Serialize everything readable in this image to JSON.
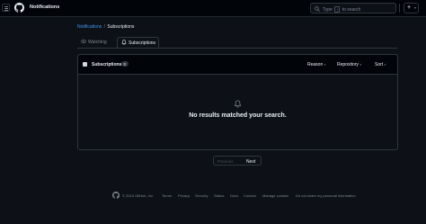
{
  "header": {
    "title": "Notifications",
    "search_placeholder_before": "Type",
    "search_key": "/",
    "search_placeholder_after": "to search",
    "plus_icon": "+",
    "caret_icon": "▾"
  },
  "breadcrumb": {
    "parent": "Notifications",
    "separator": "/",
    "current": "Subscriptions"
  },
  "tabs": {
    "watching": "Watching",
    "subscriptions": "Subscriptions"
  },
  "list": {
    "title": "Subscriptions",
    "count": "0",
    "filters": {
      "reason": "Reason",
      "repository": "Repository",
      "sort": "Sort"
    },
    "dropdown_icon": "▾",
    "empty_message": "No results matched your search."
  },
  "pagination": {
    "previous": "Previous",
    "next": "Next"
  },
  "footer": {
    "copyright": "© 2024 GitHub, Inc.",
    "links": [
      "Terms",
      "Privacy",
      "Security",
      "Status",
      "Docs",
      "Contact",
      "Manage cookies",
      "Do not share my personal information"
    ]
  },
  "colors": {
    "background": "#0d1117",
    "header_bg": "#010409",
    "border": "#30363d",
    "link": "#4493f8",
    "muted": "#7d8590",
    "text": "#e6edf3"
  }
}
